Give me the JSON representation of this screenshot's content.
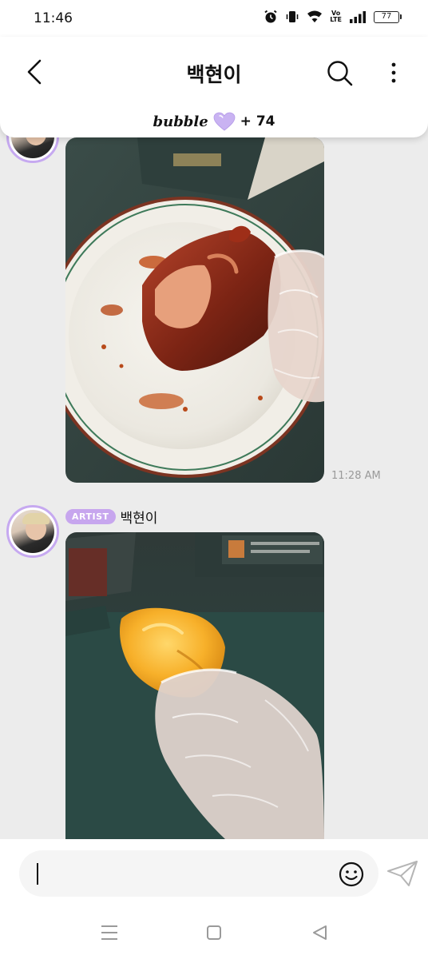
{
  "status_bar": {
    "time": "11:46",
    "volte_top": "Vo",
    "volte_bottom": "LTE",
    "battery": "77",
    "icons": [
      "alarm-icon",
      "vibrate-icon",
      "wifi-icon",
      "volte-icon",
      "signal-icon",
      "battery-icon"
    ]
  },
  "header": {
    "title": "백현이",
    "back_icon": "chevron-left-icon",
    "search_icon": "search-icon",
    "more_icon": "more-vertical-icon",
    "bubble_label": "bubble",
    "bubble_plus": "+ 74",
    "bubble_heart_color": "#c9b3f2"
  },
  "messages": [
    {
      "type": "photo",
      "image": "roasted chicken on a white plate held by a gloved hand",
      "time": "11:28 AM"
    },
    {
      "type": "photo",
      "badge": "ARTIST",
      "sender": "백현이",
      "image": "fried golden dumpling held by a gloved hand"
    }
  ],
  "input_bar": {
    "emoji_icon": "emoji-icon",
    "send_icon": "send-icon"
  },
  "nav_bar": {
    "icons": [
      "recent-apps-icon",
      "home-icon",
      "back-triangle-icon"
    ]
  },
  "colors": {
    "accent_purple": "#c7a6ee",
    "chat_background": "#ececec"
  }
}
